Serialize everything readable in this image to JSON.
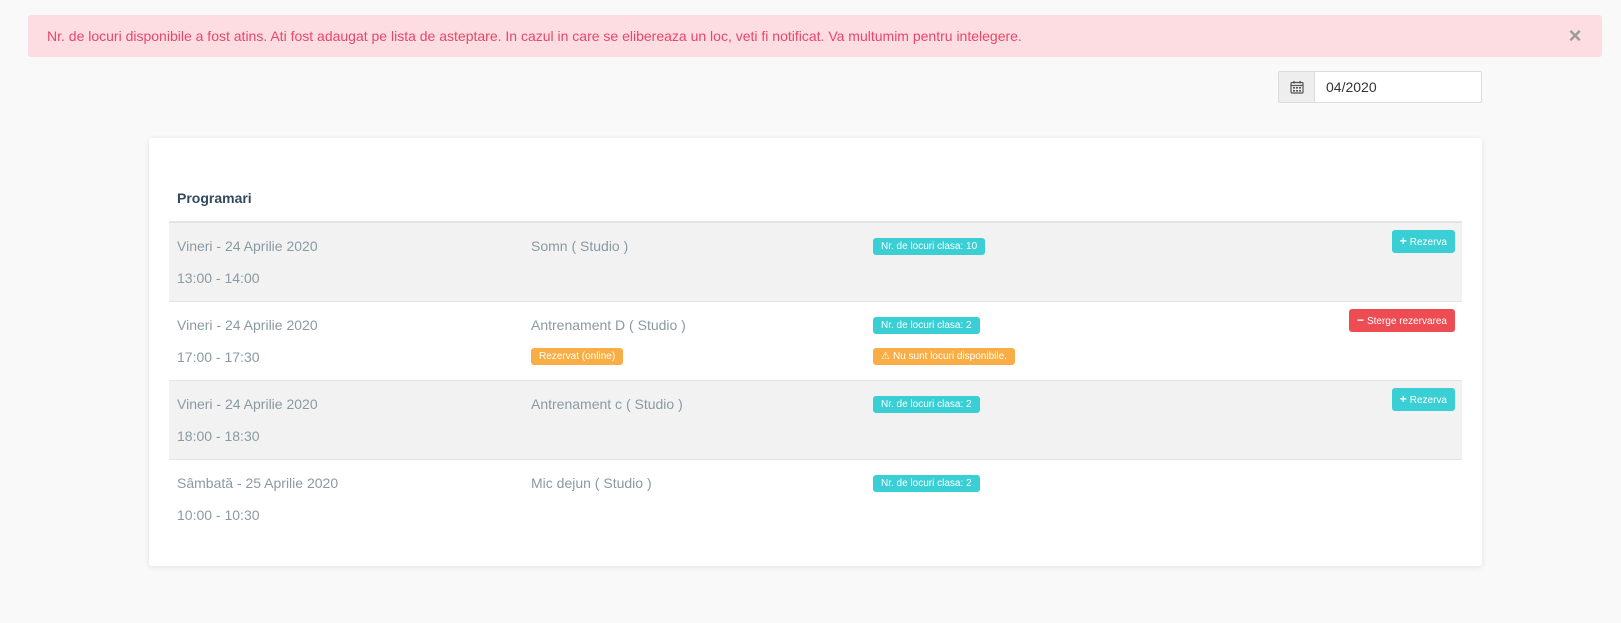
{
  "alert": {
    "message": "Nr. de locuri disponibile a fost atins. Ati fost adaugat pe lista de asteptare. In cazul in care se elibereaza un loc, veti fi notificat. Va multumim pentru intelegere.",
    "close_glyph": "×",
    "close_icon": "close-icon"
  },
  "date_picker": {
    "icon": "calendar-icon",
    "value": "04/2020"
  },
  "card": {
    "title": "Programari"
  },
  "rows": [
    {
      "date": "Vineri - 24 Aprilie 2020",
      "time": "13:00 - 14:00",
      "class_name": "Somn ( Studio )",
      "spots_badge": "Nr. de locuri clasa: 10",
      "action": {
        "icon": "plus-icon",
        "glyph": "+",
        "label": "Rezerva"
      }
    },
    {
      "date": "Vineri - 24 Aprilie 2020",
      "time": "17:00 - 17:30",
      "class_name": "Antrenament D ( Studio )",
      "spots_badge": "Nr. de locuri clasa: 2",
      "status_badge": "Rezervat (online)",
      "warning_badge": "Nu sunt locuri disponibile.",
      "warning_glyph": "⚠",
      "action": {
        "icon": "minus-icon",
        "glyph": "−",
        "label": "Sterge rezervarea"
      }
    },
    {
      "date": "Vineri - 24 Aprilie 2020",
      "time": "18:00 - 18:30",
      "class_name": "Antrenament c ( Studio )",
      "spots_badge": "Nr. de locuri clasa: 2",
      "action": {
        "icon": "plus-icon",
        "glyph": "+",
        "label": "Rezerva"
      }
    },
    {
      "date": "Sâmbată - 25 Aprilie 2020",
      "time": "10:00 - 10:30",
      "class_name": "Mic dejun ( Studio )",
      "spots_badge": "Nr. de locuri clasa: 2"
    }
  ],
  "colors": {
    "teal": "#3acfd5",
    "orange": "#f9ad45",
    "red": "#ed4c53",
    "alert_bg": "#fddde2",
    "alert_text": "#e8476a"
  }
}
